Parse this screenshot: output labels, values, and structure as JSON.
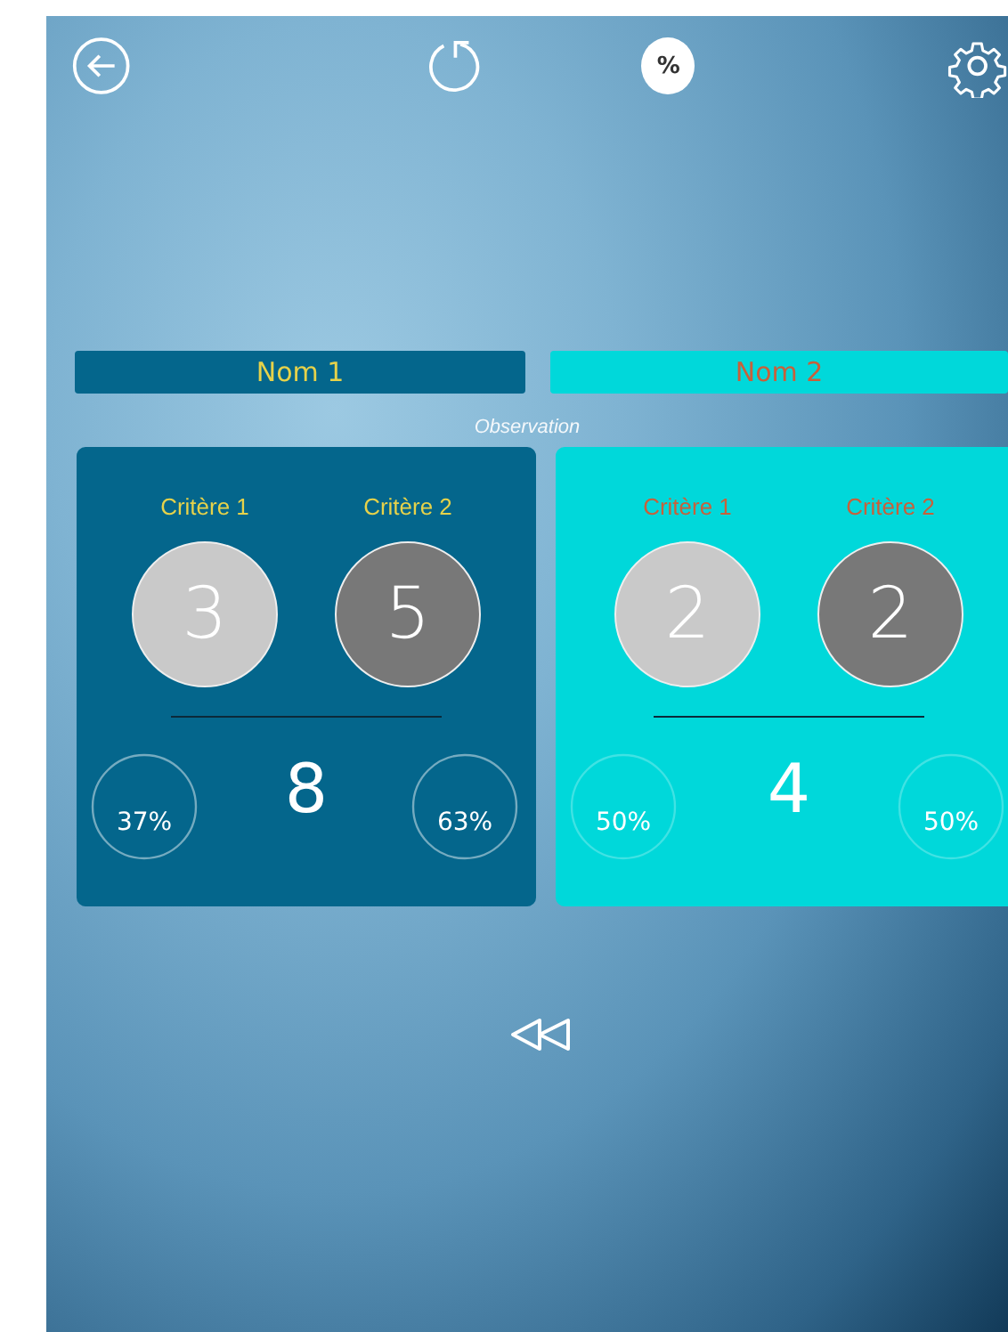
{
  "toolbar": {
    "percent_label": "%"
  },
  "section_label": "Observation",
  "teams": [
    {
      "name": "Nom 1",
      "kind": "dark",
      "color": "#04668c",
      "total": "8",
      "criteria": [
        {
          "label": "Critère 1",
          "score": "3",
          "percent": "37%"
        },
        {
          "label": "Critère 2",
          "score": "5",
          "percent": "63%"
        }
      ]
    },
    {
      "name": "Nom 2",
      "kind": "light",
      "color": "#00d8da",
      "total": "4",
      "criteria": [
        {
          "label": "Critère 1",
          "score": "2",
          "percent": "50%"
        },
        {
          "label": "Critère 2",
          "score": "2",
          "percent": "50%"
        }
      ]
    }
  ]
}
